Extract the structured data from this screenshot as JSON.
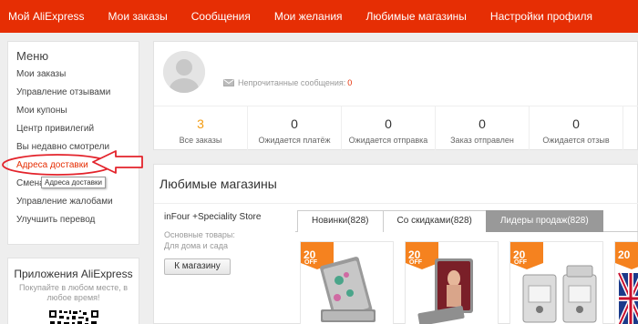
{
  "nav": {
    "items": [
      "Мой AliExpress",
      "Мои заказы",
      "Сообщения",
      "Мои желания",
      "Любимые магазины",
      "Настройки профиля"
    ]
  },
  "sidebar": {
    "title": "Меню",
    "items": [
      "Мои заказы",
      "Управление отзывами",
      "Мои купоны",
      "Центр привилегий",
      "Вы недавно смотрели",
      "Адреса доставки",
      "Смена",
      "Управление жалобами",
      "Улучшить перевод"
    ],
    "tooltip": "Адреса доставки"
  },
  "apps": {
    "title": "Приложения AliExpress",
    "subtitle_line1": "Покупайте в любом месте, в",
    "subtitle_line2": "любое время!"
  },
  "profile": {
    "messages_label": "Непрочитанные сообщения:",
    "messages_count": "0",
    "stats": [
      {
        "num": "3",
        "label": "Все заказы"
      },
      {
        "num": "0",
        "label": "Ожидается платёж"
      },
      {
        "num": "0",
        "label": "Ожидается отправка"
      },
      {
        "num": "0",
        "label": "Заказ отправлен"
      },
      {
        "num": "0",
        "label": "Ожидается отзыв"
      }
    ]
  },
  "stores": {
    "title": "Любимые магазины",
    "store_name": "inFour +Speciality Store",
    "categories_label": "Основные товары:",
    "categories": "Для дома и сада",
    "button": "К магазину",
    "tabs": [
      "Новинки(828)",
      "Со скидками(828)",
      "Лидеры продаж(828)"
    ],
    "products": [
      {
        "badge_num": "20",
        "badge_off": "OFF"
      },
      {
        "badge_num": "20",
        "badge_off": "OFF"
      },
      {
        "badge_num": "20",
        "badge_off": "OFF"
      },
      {
        "badge_num": "20",
        "badge_off": ""
      }
    ]
  },
  "colors": {
    "brand": "#e62e04",
    "badge": "#f5821f",
    "annotation": "#e3232b"
  }
}
